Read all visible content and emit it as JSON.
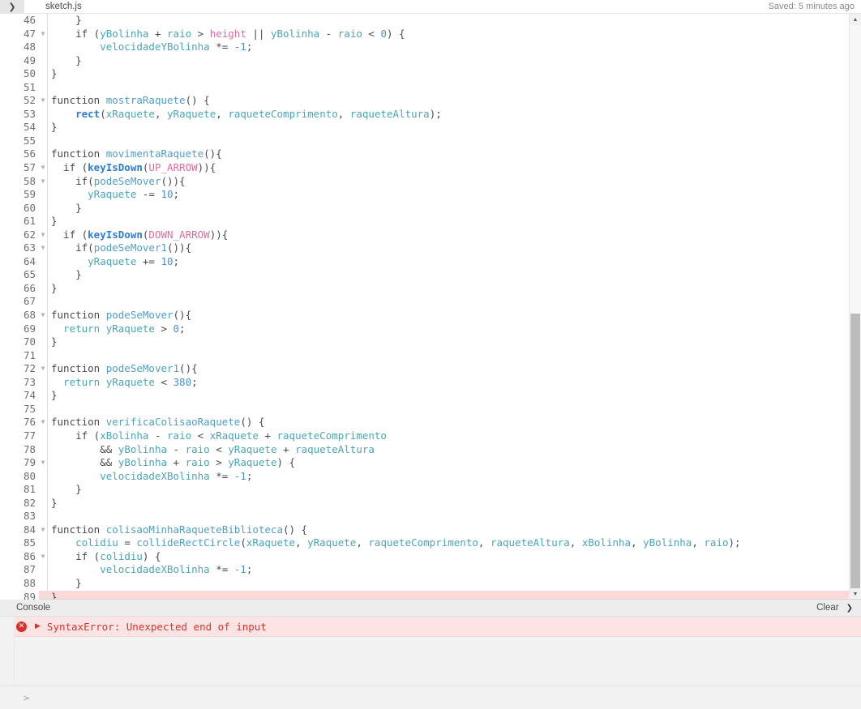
{
  "tabbar": {
    "toggle_icon": "chevron-right-icon",
    "filename": "sketch.js",
    "saved_status": "Saved: 5 minutes ago"
  },
  "editor": {
    "first_line_number": 46,
    "fold_icon": "triangle-down-icon",
    "error_line": 89,
    "lines": [
      {
        "n": 46,
        "fold": false,
        "err": false,
        "tokens": [
          {
            "t": "pun",
            "v": "    }"
          }
        ]
      },
      {
        "n": 47,
        "fold": true,
        "err": false,
        "tokens": [
          {
            "t": "kw",
            "v": "    if ("
          },
          {
            "t": "var",
            "v": "yBolinha"
          },
          {
            "t": "op",
            "v": " + "
          },
          {
            "t": "var",
            "v": "raio"
          },
          {
            "t": "op",
            "v": " > "
          },
          {
            "t": "const",
            "v": "height"
          },
          {
            "t": "op",
            "v": " || "
          },
          {
            "t": "var",
            "v": "yBolinha"
          },
          {
            "t": "op",
            "v": " - "
          },
          {
            "t": "var",
            "v": "raio"
          },
          {
            "t": "op",
            "v": " < "
          },
          {
            "t": "num",
            "v": "0"
          },
          {
            "t": "pun",
            "v": ") {"
          }
        ]
      },
      {
        "n": 48,
        "fold": false,
        "err": false,
        "tokens": [
          {
            "t": "var",
            "v": "        velocidadeYBolinha"
          },
          {
            "t": "op",
            "v": " *= "
          },
          {
            "t": "num",
            "v": "-1"
          },
          {
            "t": "pun",
            "v": ";"
          }
        ]
      },
      {
        "n": 49,
        "fold": false,
        "err": false,
        "tokens": [
          {
            "t": "pun",
            "v": "    }"
          }
        ]
      },
      {
        "n": 50,
        "fold": false,
        "err": false,
        "tokens": [
          {
            "t": "pun",
            "v": "}"
          }
        ]
      },
      {
        "n": 51,
        "fold": false,
        "err": false,
        "tokens": [
          {
            "t": "pun",
            "v": ""
          }
        ]
      },
      {
        "n": 52,
        "fold": true,
        "err": false,
        "tokens": [
          {
            "t": "kw",
            "v": "function "
          },
          {
            "t": "fn",
            "v": "mostraRaquete"
          },
          {
            "t": "pun",
            "v": "() {"
          }
        ]
      },
      {
        "n": 53,
        "fold": false,
        "err": false,
        "tokens": [
          {
            "t": "pun",
            "v": "    "
          },
          {
            "t": "bi",
            "v": "rect"
          },
          {
            "t": "pun",
            "v": "("
          },
          {
            "t": "var",
            "v": "xRaquete"
          },
          {
            "t": "pun",
            "v": ", "
          },
          {
            "t": "var",
            "v": "yRaquete"
          },
          {
            "t": "pun",
            "v": ", "
          },
          {
            "t": "var",
            "v": "raqueteComprimento"
          },
          {
            "t": "pun",
            "v": ", "
          },
          {
            "t": "var",
            "v": "raqueteAltura"
          },
          {
            "t": "pun",
            "v": ");"
          }
        ]
      },
      {
        "n": 54,
        "fold": false,
        "err": false,
        "tokens": [
          {
            "t": "pun",
            "v": "}"
          }
        ]
      },
      {
        "n": 55,
        "fold": false,
        "err": false,
        "tokens": [
          {
            "t": "pun",
            "v": ""
          }
        ]
      },
      {
        "n": 56,
        "fold": false,
        "err": false,
        "tokens": [
          {
            "t": "kw",
            "v": "function "
          },
          {
            "t": "fn",
            "v": "movimentaRaquete"
          },
          {
            "t": "pun",
            "v": "(){"
          }
        ]
      },
      {
        "n": 57,
        "fold": true,
        "err": false,
        "tokens": [
          {
            "t": "kw",
            "v": "  if ("
          },
          {
            "t": "bi",
            "v": "keyIsDown"
          },
          {
            "t": "pun",
            "v": "("
          },
          {
            "t": "const",
            "v": "UP_ARROW"
          },
          {
            "t": "pun",
            "v": ")){"
          }
        ]
      },
      {
        "n": 58,
        "fold": true,
        "err": false,
        "tokens": [
          {
            "t": "kw",
            "v": "    if("
          },
          {
            "t": "fn",
            "v": "podeSeMover"
          },
          {
            "t": "pun",
            "v": "()){"
          }
        ]
      },
      {
        "n": 59,
        "fold": false,
        "err": false,
        "tokens": [
          {
            "t": "var",
            "v": "      yRaquete"
          },
          {
            "t": "op",
            "v": " -= "
          },
          {
            "t": "num",
            "v": "10"
          },
          {
            "t": "pun",
            "v": ";"
          }
        ]
      },
      {
        "n": 60,
        "fold": false,
        "err": false,
        "tokens": [
          {
            "t": "pun",
            "v": "    }"
          }
        ]
      },
      {
        "n": 61,
        "fold": false,
        "err": false,
        "tokens": [
          {
            "t": "pun",
            "v": "}"
          }
        ]
      },
      {
        "n": 62,
        "fold": true,
        "err": false,
        "tokens": [
          {
            "t": "kw",
            "v": "  if ("
          },
          {
            "t": "bi",
            "v": "keyIsDown"
          },
          {
            "t": "pun",
            "v": "("
          },
          {
            "t": "const",
            "v": "DOWN_ARROW"
          },
          {
            "t": "pun",
            "v": ")){"
          }
        ]
      },
      {
        "n": 63,
        "fold": true,
        "err": false,
        "tokens": [
          {
            "t": "kw",
            "v": "    if("
          },
          {
            "t": "fn",
            "v": "podeSeMover1"
          },
          {
            "t": "pun",
            "v": "()){"
          }
        ]
      },
      {
        "n": 64,
        "fold": false,
        "err": false,
        "tokens": [
          {
            "t": "var",
            "v": "      yRaquete"
          },
          {
            "t": "op",
            "v": " += "
          },
          {
            "t": "num",
            "v": "10"
          },
          {
            "t": "pun",
            "v": ";"
          }
        ]
      },
      {
        "n": 65,
        "fold": false,
        "err": false,
        "tokens": [
          {
            "t": "pun",
            "v": "    }"
          }
        ]
      },
      {
        "n": 66,
        "fold": false,
        "err": false,
        "tokens": [
          {
            "t": "pun",
            "v": "}"
          }
        ]
      },
      {
        "n": 67,
        "fold": false,
        "err": false,
        "tokens": [
          {
            "t": "pun",
            "v": ""
          }
        ]
      },
      {
        "n": 68,
        "fold": true,
        "err": false,
        "tokens": [
          {
            "t": "kw",
            "v": "function "
          },
          {
            "t": "fn",
            "v": "podeSeMover"
          },
          {
            "t": "pun",
            "v": "(){"
          }
        ]
      },
      {
        "n": 69,
        "fold": false,
        "err": false,
        "tokens": [
          {
            "t": "var",
            "v": "  return yRaquete"
          },
          {
            "t": "op",
            "v": " > "
          },
          {
            "t": "num",
            "v": "0"
          },
          {
            "t": "pun",
            "v": ";"
          }
        ]
      },
      {
        "n": 70,
        "fold": false,
        "err": false,
        "tokens": [
          {
            "t": "pun",
            "v": "}"
          }
        ]
      },
      {
        "n": 71,
        "fold": false,
        "err": false,
        "tokens": [
          {
            "t": "pun",
            "v": ""
          }
        ]
      },
      {
        "n": 72,
        "fold": true,
        "err": false,
        "tokens": [
          {
            "t": "kw",
            "v": "function "
          },
          {
            "t": "fn",
            "v": "podeSeMover1"
          },
          {
            "t": "pun",
            "v": "(){"
          }
        ]
      },
      {
        "n": 73,
        "fold": false,
        "err": false,
        "tokens": [
          {
            "t": "var",
            "v": "  return yRaquete"
          },
          {
            "t": "op",
            "v": " < "
          },
          {
            "t": "num",
            "v": "380"
          },
          {
            "t": "pun",
            "v": ";"
          }
        ]
      },
      {
        "n": 74,
        "fold": false,
        "err": false,
        "tokens": [
          {
            "t": "pun",
            "v": "}"
          }
        ]
      },
      {
        "n": 75,
        "fold": false,
        "err": false,
        "tokens": [
          {
            "t": "pun",
            "v": ""
          }
        ]
      },
      {
        "n": 76,
        "fold": true,
        "err": false,
        "tokens": [
          {
            "t": "kw",
            "v": "function "
          },
          {
            "t": "fn",
            "v": "verificaColisaoRaquete"
          },
          {
            "t": "pun",
            "v": "() {"
          }
        ]
      },
      {
        "n": 77,
        "fold": false,
        "err": false,
        "tokens": [
          {
            "t": "kw",
            "v": "    if ("
          },
          {
            "t": "var",
            "v": "xBolinha"
          },
          {
            "t": "op",
            "v": " - "
          },
          {
            "t": "var",
            "v": "raio"
          },
          {
            "t": "op",
            "v": " < "
          },
          {
            "t": "var",
            "v": "xRaquete"
          },
          {
            "t": "op",
            "v": " + "
          },
          {
            "t": "var",
            "v": "raqueteComprimento"
          }
        ]
      },
      {
        "n": 78,
        "fold": false,
        "err": false,
        "tokens": [
          {
            "t": "op",
            "v": "        && "
          },
          {
            "t": "var",
            "v": "yBolinha"
          },
          {
            "t": "op",
            "v": " - "
          },
          {
            "t": "var",
            "v": "raio"
          },
          {
            "t": "op",
            "v": " < "
          },
          {
            "t": "var",
            "v": "yRaquete"
          },
          {
            "t": "op",
            "v": " + "
          },
          {
            "t": "var",
            "v": "raqueteAltura"
          }
        ]
      },
      {
        "n": 79,
        "fold": true,
        "err": false,
        "tokens": [
          {
            "t": "op",
            "v": "        && "
          },
          {
            "t": "var",
            "v": "yBolinha"
          },
          {
            "t": "op",
            "v": " + "
          },
          {
            "t": "var",
            "v": "raio"
          },
          {
            "t": "op",
            "v": " > "
          },
          {
            "t": "var",
            "v": "yRaquete"
          },
          {
            "t": "pun",
            "v": ") {"
          }
        ]
      },
      {
        "n": 80,
        "fold": false,
        "err": false,
        "tokens": [
          {
            "t": "var",
            "v": "        velocidadeXBolinha"
          },
          {
            "t": "op",
            "v": " *= "
          },
          {
            "t": "num",
            "v": "-1"
          },
          {
            "t": "pun",
            "v": ";"
          }
        ]
      },
      {
        "n": 81,
        "fold": false,
        "err": false,
        "tokens": [
          {
            "t": "pun",
            "v": "    }"
          }
        ]
      },
      {
        "n": 82,
        "fold": false,
        "err": false,
        "tokens": [
          {
            "t": "pun",
            "v": "}"
          }
        ]
      },
      {
        "n": 83,
        "fold": false,
        "err": false,
        "tokens": [
          {
            "t": "pun",
            "v": ""
          }
        ]
      },
      {
        "n": 84,
        "fold": true,
        "err": false,
        "tokens": [
          {
            "t": "kw",
            "v": "function "
          },
          {
            "t": "fn",
            "v": "colisaoMinhaRaqueteBiblioteca"
          },
          {
            "t": "pun",
            "v": "() {"
          }
        ]
      },
      {
        "n": 85,
        "fold": false,
        "err": false,
        "tokens": [
          {
            "t": "var",
            "v": "    colidiu"
          },
          {
            "t": "op",
            "v": " = "
          },
          {
            "t": "fn",
            "v": "collideRectCircle"
          },
          {
            "t": "pun",
            "v": "("
          },
          {
            "t": "var",
            "v": "xRaquete"
          },
          {
            "t": "pun",
            "v": ", "
          },
          {
            "t": "var",
            "v": "yRaquete"
          },
          {
            "t": "pun",
            "v": ", "
          },
          {
            "t": "var",
            "v": "raqueteComprimento"
          },
          {
            "t": "pun",
            "v": ", "
          },
          {
            "t": "var",
            "v": "raqueteAltura"
          },
          {
            "t": "pun",
            "v": ", "
          },
          {
            "t": "var",
            "v": "xBolinha"
          },
          {
            "t": "pun",
            "v": ", "
          },
          {
            "t": "var",
            "v": "yBolinha"
          },
          {
            "t": "pun",
            "v": ", "
          },
          {
            "t": "var",
            "v": "raio"
          },
          {
            "t": "pun",
            "v": ");"
          }
        ]
      },
      {
        "n": 86,
        "fold": true,
        "err": false,
        "tokens": [
          {
            "t": "kw",
            "v": "    if ("
          },
          {
            "t": "var",
            "v": "colidiu"
          },
          {
            "t": "pun",
            "v": ") {"
          }
        ]
      },
      {
        "n": 87,
        "fold": false,
        "err": false,
        "tokens": [
          {
            "t": "var",
            "v": "        velocidadeXBolinha"
          },
          {
            "t": "op",
            "v": " *= "
          },
          {
            "t": "num",
            "v": "-1"
          },
          {
            "t": "pun",
            "v": ";"
          }
        ]
      },
      {
        "n": 88,
        "fold": false,
        "err": false,
        "tokens": [
          {
            "t": "pun",
            "v": "    }"
          }
        ]
      },
      {
        "n": 89,
        "fold": false,
        "err": true,
        "tokens": [
          {
            "t": "pun",
            "v": "}"
          }
        ]
      }
    ],
    "scrollbar": {
      "up_arrow_icon": "triangle-up-icon",
      "down_arrow_icon": "triangle-down-icon"
    }
  },
  "console": {
    "title": "Console",
    "clear_label": "Clear",
    "collapse_icon": "chevron-down-icon",
    "messages": [
      {
        "icon": "error-circle-icon",
        "expand_icon": "triangle-right-icon",
        "text": "SyntaxError: Unexpected end of input",
        "level": "error"
      }
    ],
    "prompt_caret": ">"
  },
  "colors": {
    "error_bg": "#fde4e4",
    "error_text": "#d9322c",
    "error_line_bg": "#fcd9d9",
    "variable": "#4aa5b5",
    "function": "#4f9fc4",
    "builtin": "#2d7dd2",
    "constant": "#e06c9f",
    "number": "#4a90d9",
    "keyword": "#4a4a4a"
  }
}
